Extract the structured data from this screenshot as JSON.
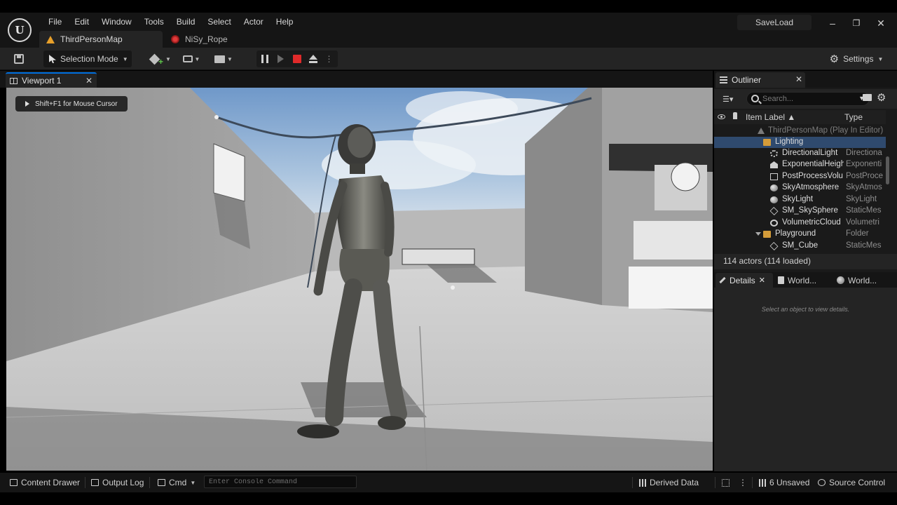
{
  "app": {
    "project_name": "SaveLoad",
    "menu": [
      "File",
      "Edit",
      "Window",
      "Tools",
      "Build",
      "Select",
      "Actor",
      "Help"
    ],
    "doc_tabs": [
      {
        "label": "ThirdPersonMap",
        "icon": "warning-icon",
        "active": true
      },
      {
        "label": "NiSy_Rope",
        "icon": "niagara-system-icon",
        "active": false
      }
    ],
    "window_controls": {
      "minimize": "–",
      "restore": "❐",
      "close": "✕"
    }
  },
  "toolbar": {
    "mode_label": "Selection Mode",
    "settings_label": "Settings"
  },
  "viewport": {
    "tab_label": "Viewport 1",
    "hint": "Shift+F1 for Mouse Cursor"
  },
  "outliner": {
    "tab_label": "Outliner",
    "search_placeholder": "Search...",
    "col_label": "Item Label",
    "col_type": "Type",
    "rows": [
      {
        "label": "ThirdPersonMap (Play In Editor)",
        "type": "",
        "icon": "world-icon",
        "indent": 0,
        "selected": false,
        "dim": true
      },
      {
        "label": "Lighting",
        "type": "",
        "icon": "folder-icon",
        "indent": 1,
        "selected": true
      },
      {
        "label": "DirectionalLight",
        "type": "Directiona",
        "icon": "sun-icon",
        "indent": 2
      },
      {
        "label": "ExponentialHeigh",
        "type": "Exponenti",
        "icon": "fog-icon",
        "indent": 2
      },
      {
        "label": "PostProcessVolu",
        "type": "PostProce",
        "icon": "volume-icon",
        "indent": 2
      },
      {
        "label": "SkyAtmosphere",
        "type": "SkyAtmos",
        "icon": "sky-icon",
        "indent": 2
      },
      {
        "label": "SkyLight",
        "type": "SkyLight",
        "icon": "skylight-icon",
        "indent": 2
      },
      {
        "label": "SM_SkySphere",
        "type": "StaticMes",
        "icon": "mesh-icon",
        "indent": 2
      },
      {
        "label": "VolumetricCloud",
        "type": "Volumetri",
        "icon": "cloud-icon",
        "indent": 2
      },
      {
        "label": "Playground",
        "type": "Folder",
        "icon": "folder-icon",
        "indent": 1,
        "expanded": true
      },
      {
        "label": "SM_Cube",
        "type": "StaticMes",
        "icon": "mesh-icon",
        "indent": 2
      }
    ],
    "footer": "114 actors (114 loaded)"
  },
  "details": {
    "tabs": [
      "Details",
      "World...",
      "World..."
    ],
    "empty_text": "Select an object to view details."
  },
  "statusbar": {
    "content_drawer": "Content Drawer",
    "output_log": "Output Log",
    "cmd_label": "Cmd",
    "cmd_placeholder": "Enter Console Command",
    "derived_data": "Derived Data",
    "unsaved": "6 Unsaved",
    "source_control": "Source Control"
  }
}
